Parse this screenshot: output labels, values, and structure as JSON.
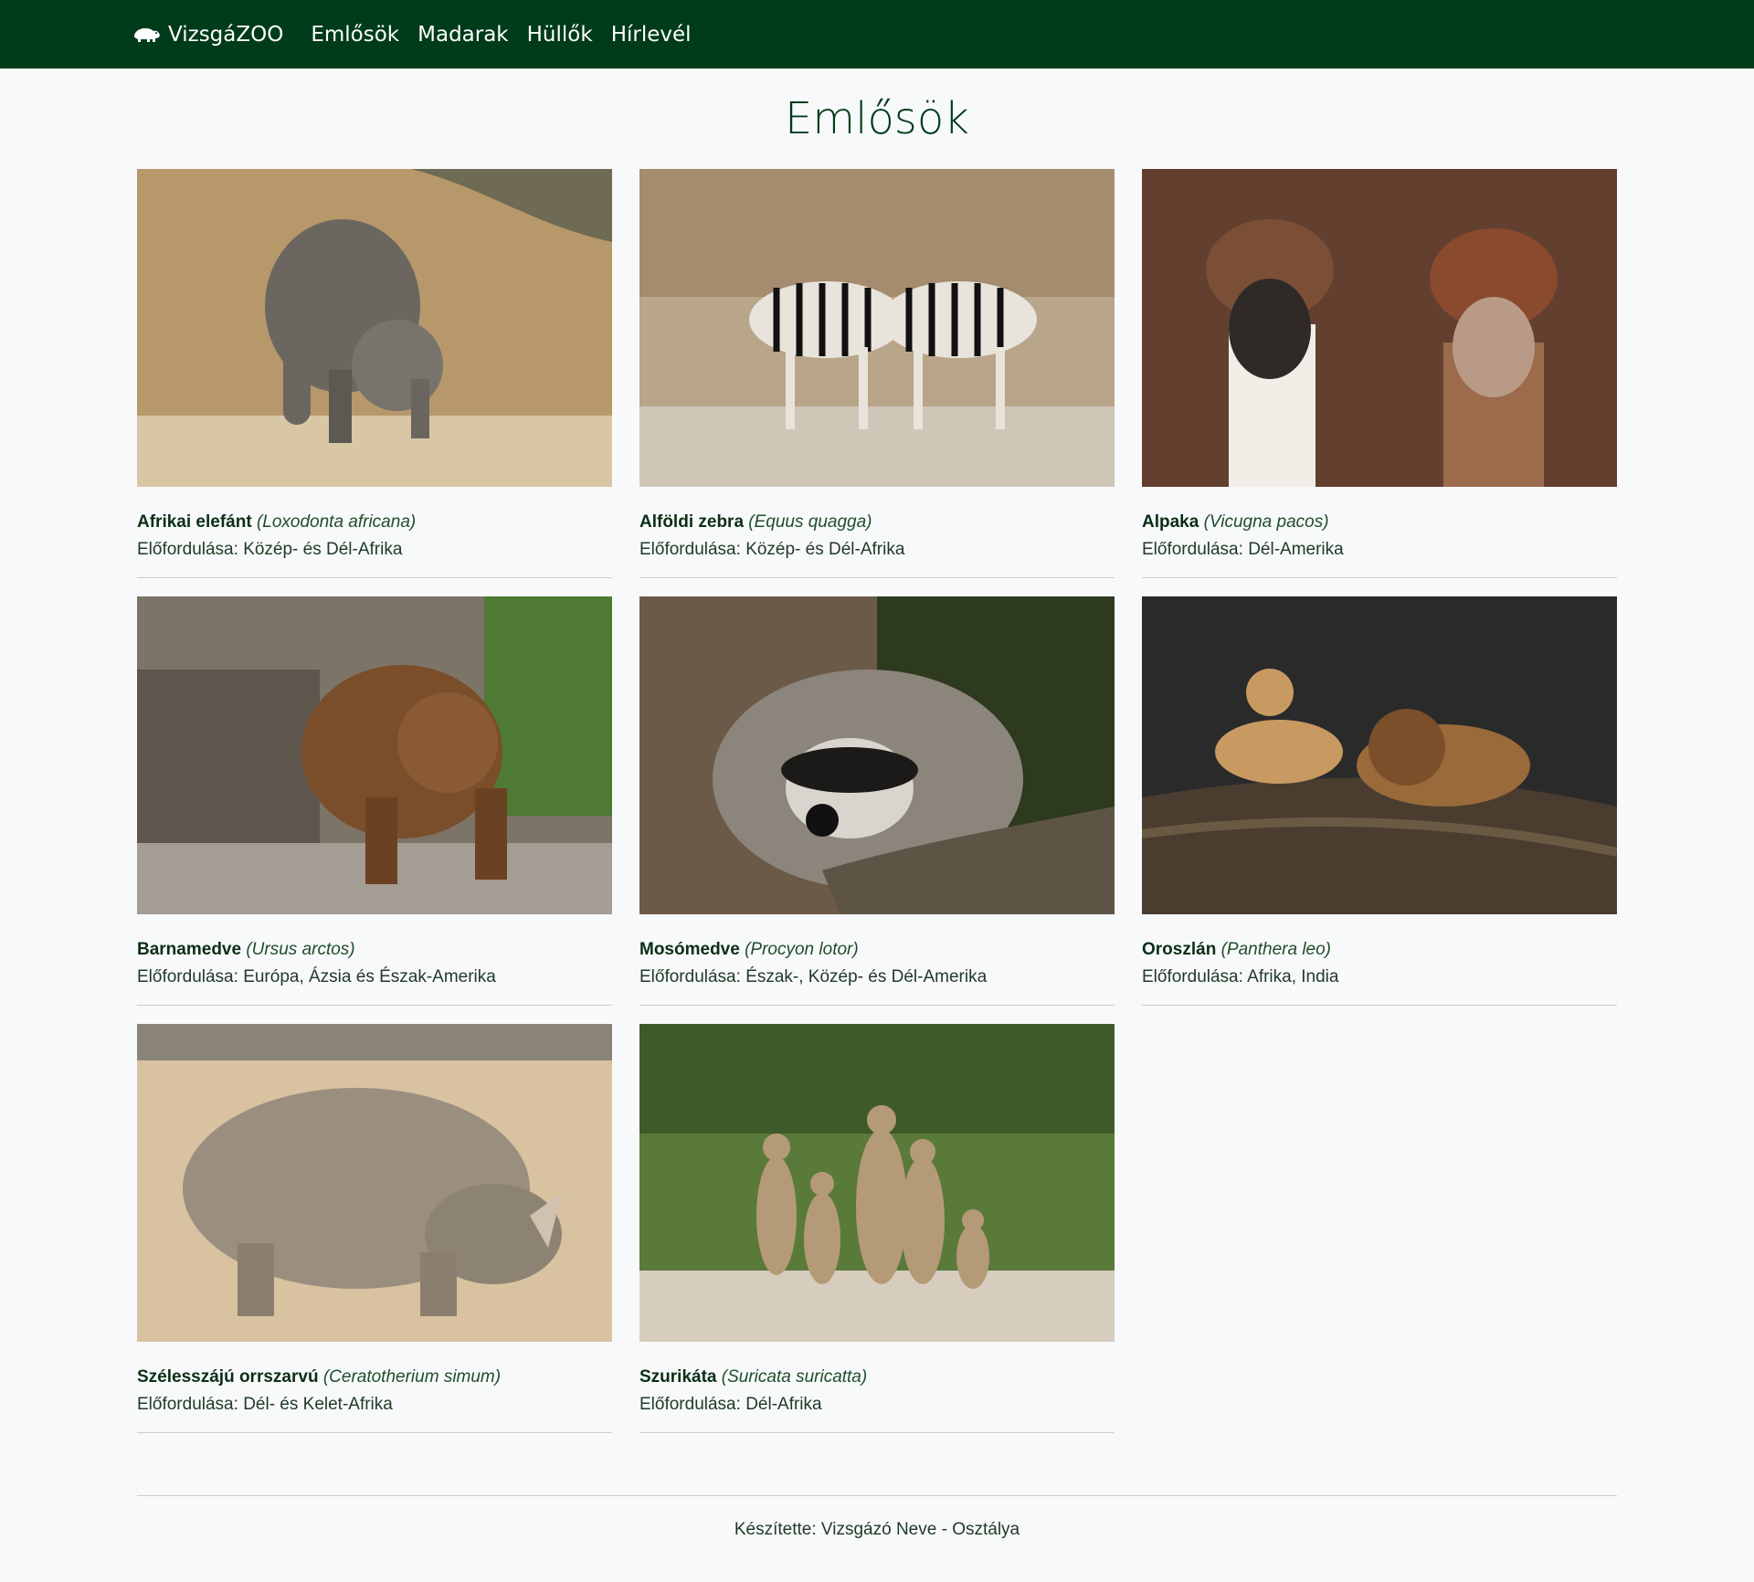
{
  "nav": {
    "brand": "VizsgáZOO",
    "brand_icon": "hippo-icon",
    "links": [
      "Emlősök",
      "Madarak",
      "Hüllők",
      "Hírlevél"
    ]
  },
  "page": {
    "title": "Emlősök"
  },
  "animals": [
    {
      "name": "Afrikai elefánt",
      "latin": "(Loxodonta africana)",
      "habitat_label": "Előfordulása:",
      "habitat": "Közép- és Dél-Afrika"
    },
    {
      "name": "Alföldi zebra",
      "latin": "(Equus quagga)",
      "habitat_label": "Előfordulása:",
      "habitat": "Közép- és Dél-Afrika"
    },
    {
      "name": "Alpaka",
      "latin": "(Vicugna pacos)",
      "habitat_label": "Előfordulása:",
      "habitat": "Dél-Amerika"
    },
    {
      "name": "Barnamedve",
      "latin": "(Ursus arctos)",
      "habitat_label": "Előfordulása:",
      "habitat": "Európa, Ázsia és Észak-Amerika"
    },
    {
      "name": "Mosómedve",
      "latin": "(Procyon lotor)",
      "habitat_label": "Előfordulása:",
      "habitat": "Észak-, Közép- és Dél-Amerika"
    },
    {
      "name": "Oroszlán",
      "latin": "(Panthera leo)",
      "habitat_label": "Előfordulása:",
      "habitat": "Afrika, India"
    },
    {
      "name": "Szélesszájú orrszarvú",
      "latin": "(Ceratotherium simum)",
      "habitat_label": "Előfordulása:",
      "habitat": "Dél- és Kelet-Afrika"
    },
    {
      "name": "Szurikáta",
      "latin": "(Suricata suricatta)",
      "habitat_label": "Előfordulása:",
      "habitat": "Dél-Afrika"
    }
  ],
  "footer": {
    "text": "Készítette: Vizsgázó Neve - Osztálya"
  }
}
